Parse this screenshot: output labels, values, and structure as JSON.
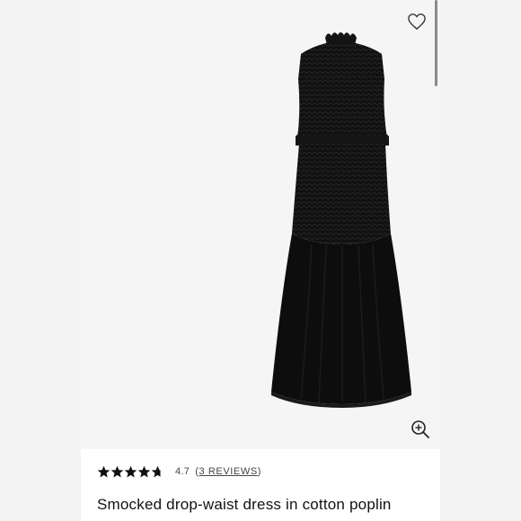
{
  "product": {
    "title": "Smocked drop-waist dress in cotton poplin",
    "image_alt": "Black smocked drop-waist sleeveless midi dress",
    "rating": {
      "value": "4.7",
      "stars_filled": 4.7,
      "stars_total": 5,
      "reviews_open": "(",
      "reviews_text": "3 REVIEWS",
      "reviews_close": ")"
    }
  },
  "icons": {
    "favorite": "heart-outline-icon",
    "zoom": "zoom-in-icon",
    "star": "star-icon"
  },
  "colors": {
    "dress": "#0d0d0d",
    "star": "#111111",
    "background": "#f5f5f5",
    "panel": "#ffffff"
  }
}
